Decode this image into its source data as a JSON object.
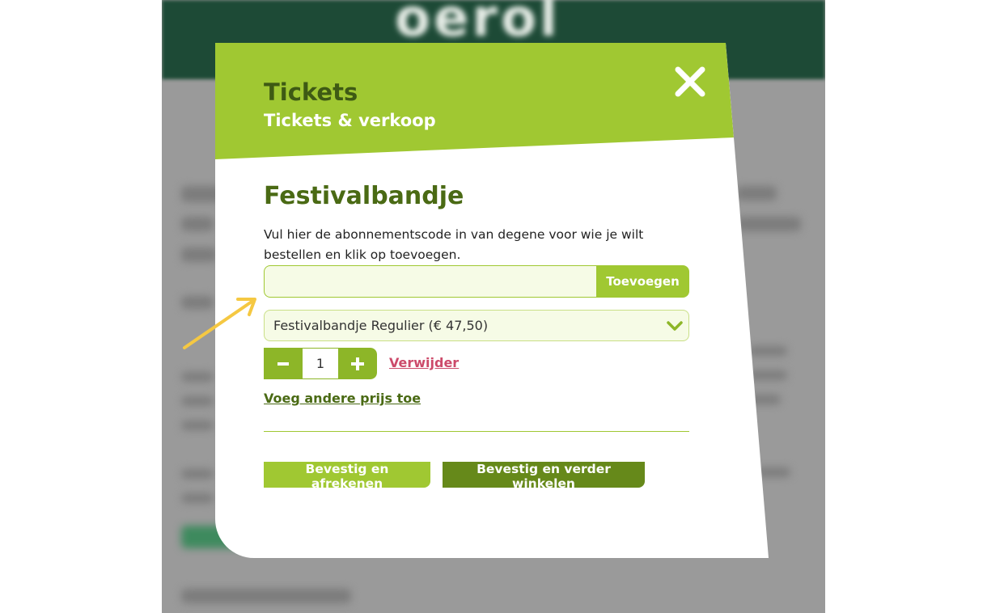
{
  "background": {
    "logo_text": "oerol"
  },
  "modal": {
    "title": "Tickets",
    "subtitle": "Tickets & verkoop",
    "close_icon": "close-icon"
  },
  "form": {
    "section_title": "Festivalbandje",
    "instruction": "Vul hier de abonnementscode in van degene voor wie je wilt bestellen en klik op toevoegen.",
    "code_input": {
      "value": "",
      "placeholder": ""
    },
    "add_button_label": "Toevoegen",
    "price_select": {
      "selected": "Festivalbandje Regulier (€ 47,50)",
      "icon": "chevron-down-icon"
    },
    "quantity": {
      "value": "1",
      "minus_icon": "minus-icon",
      "plus_icon": "plus-icon"
    },
    "remove_label": "Verwijder",
    "add_other_price_label": "Voeg andere prijs toe"
  },
  "actions": {
    "checkout_label": "Bevestig en afrekenen",
    "continue_label": "Bevestig en verder winkelen"
  },
  "colors": {
    "header_green": "#a0c832",
    "dark_green_text": "#3e5a14",
    "button_dark_green": "#66891a",
    "remove_link": "#cc4a6a",
    "annotation_arrow": "#f5c842"
  }
}
